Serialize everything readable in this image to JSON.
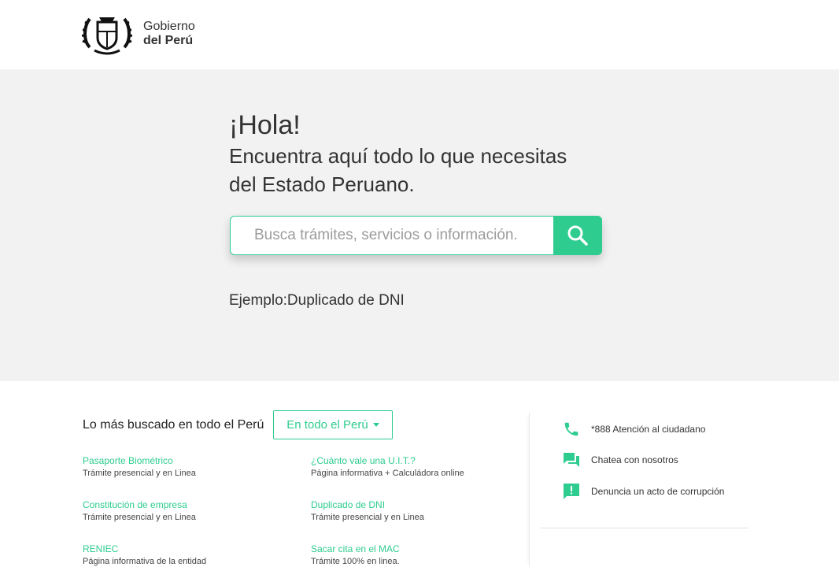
{
  "header": {
    "logo_line1": "Gobierno",
    "logo_line2": "del Perú"
  },
  "hero": {
    "greeting": "¡Hola!",
    "subtitle": "Encuentra aquí todo lo que necesitas del Estado Peruano.",
    "search_placeholder": "Busca trámites, servicios o información.",
    "example": "Ejemplo:Duplicado de DNI"
  },
  "popular": {
    "title": "Lo más buscado en todo el Perú",
    "scope_label": "En todo el Perú",
    "items": [
      {
        "name": "Pasaporte Biométrico",
        "desc": "Trámite presencial y en Linea"
      },
      {
        "name": "¿Cuánto vale una U.I.T.?",
        "desc": "Página informativa + Calculádora online"
      },
      {
        "name": "Constitución de empresa",
        "desc": "Trámite presencial y en Linea"
      },
      {
        "name": "Duplicado de DNI",
        "desc": "Trámite presencial y en Linea"
      },
      {
        "name": "RENIEC",
        "desc": "Página informativa de la entidad"
      },
      {
        "name": "Sacar cita en el MAC",
        "desc": "Trámite 100% en linea."
      }
    ]
  },
  "contact": [
    {
      "label": "*888 Atención al ciudadano",
      "icon": "phone-icon"
    },
    {
      "label": "Chatea con nosotros",
      "icon": "chat-icon"
    },
    {
      "label": "Denuncia un acto de corrupción",
      "icon": "report-icon"
    }
  ],
  "colors": {
    "accent": "#2ecc8f",
    "hero_bg": "#f2f2f2"
  }
}
